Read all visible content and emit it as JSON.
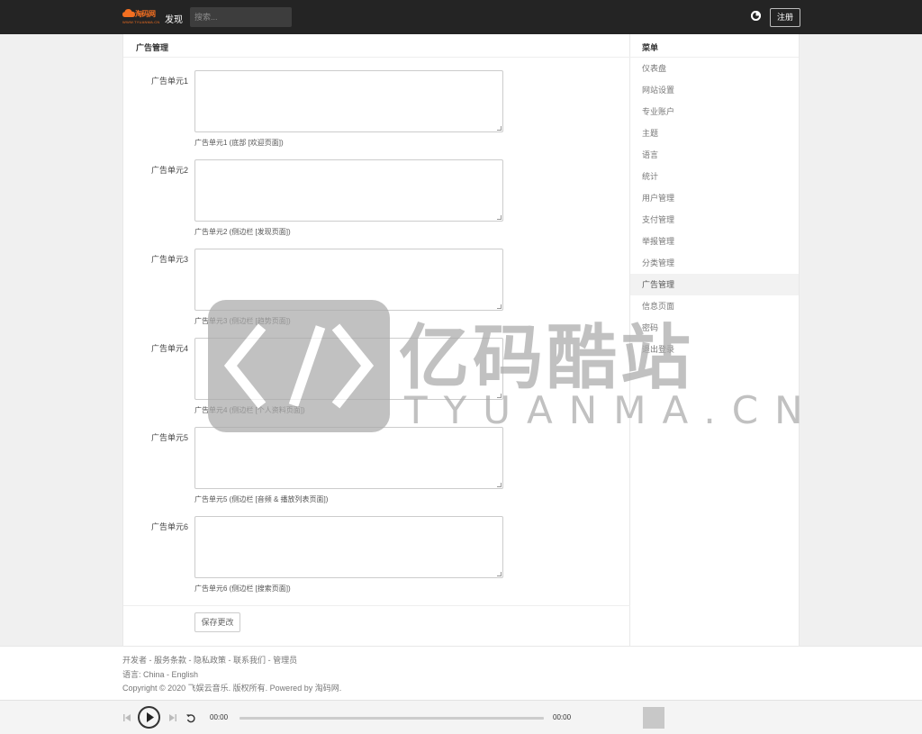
{
  "header": {
    "logo_text": "淘码网",
    "logo_sub": "WWW.TYUANMA.CN",
    "nav_discover": "发现",
    "search_placeholder": "搜索...",
    "register_label": "注册"
  },
  "main": {
    "title": "广告管理",
    "ad_units": [
      {
        "label": "广告单元1",
        "help": "广告单元1 (底部 [欢迎页面])",
        "value": ""
      },
      {
        "label": "广告单元2",
        "help": "广告单元2 (侧边栏 [发现页面])",
        "value": ""
      },
      {
        "label": "广告单元3",
        "help": "广告单元3 (侧边栏 [趋势页面])",
        "value": ""
      },
      {
        "label": "广告单元4",
        "help": "广告单元4 (侧边栏 [个人资料页面])",
        "value": ""
      },
      {
        "label": "广告单元5",
        "help": "广告单元5 (侧边栏 [音频 & 播放列表页面])",
        "value": ""
      },
      {
        "label": "广告单元6",
        "help": "广告单元6 (侧边栏 [搜索页面])",
        "value": ""
      }
    ],
    "save_label": "保存更改"
  },
  "sidebar": {
    "title": "菜单",
    "items": [
      {
        "label": "仪表盘",
        "active": false
      },
      {
        "label": "网站设置",
        "active": false
      },
      {
        "label": "专业账户",
        "active": false
      },
      {
        "label": "主题",
        "active": false
      },
      {
        "label": "语言",
        "active": false
      },
      {
        "label": "统计",
        "active": false
      },
      {
        "label": "用户管理",
        "active": false
      },
      {
        "label": "支付管理",
        "active": false
      },
      {
        "label": "举报管理",
        "active": false
      },
      {
        "label": "分类管理",
        "active": false
      },
      {
        "label": "广告管理",
        "active": true
      },
      {
        "label": "信息页面",
        "active": false
      },
      {
        "label": "密码",
        "active": false
      },
      {
        "label": "退出登录",
        "active": false
      }
    ]
  },
  "footer": {
    "links": [
      "开发者",
      "服务条款",
      "隐私政策",
      "联系我们",
      "管理员"
    ],
    "language_prefix": "语言:",
    "languages": [
      "China",
      "English"
    ],
    "copyright": "Copyright © 2020 飞娱云音乐. 版权所有. Powered by 淘码网."
  },
  "player": {
    "time_current": "00:00",
    "time_total": "00:00",
    "progress": 0
  },
  "watermark": {
    "cn": "亿码酷站",
    "en": "TYUANMA.CN"
  },
  "colors": {
    "topbar": "#242424",
    "brand": "#f36f21"
  }
}
